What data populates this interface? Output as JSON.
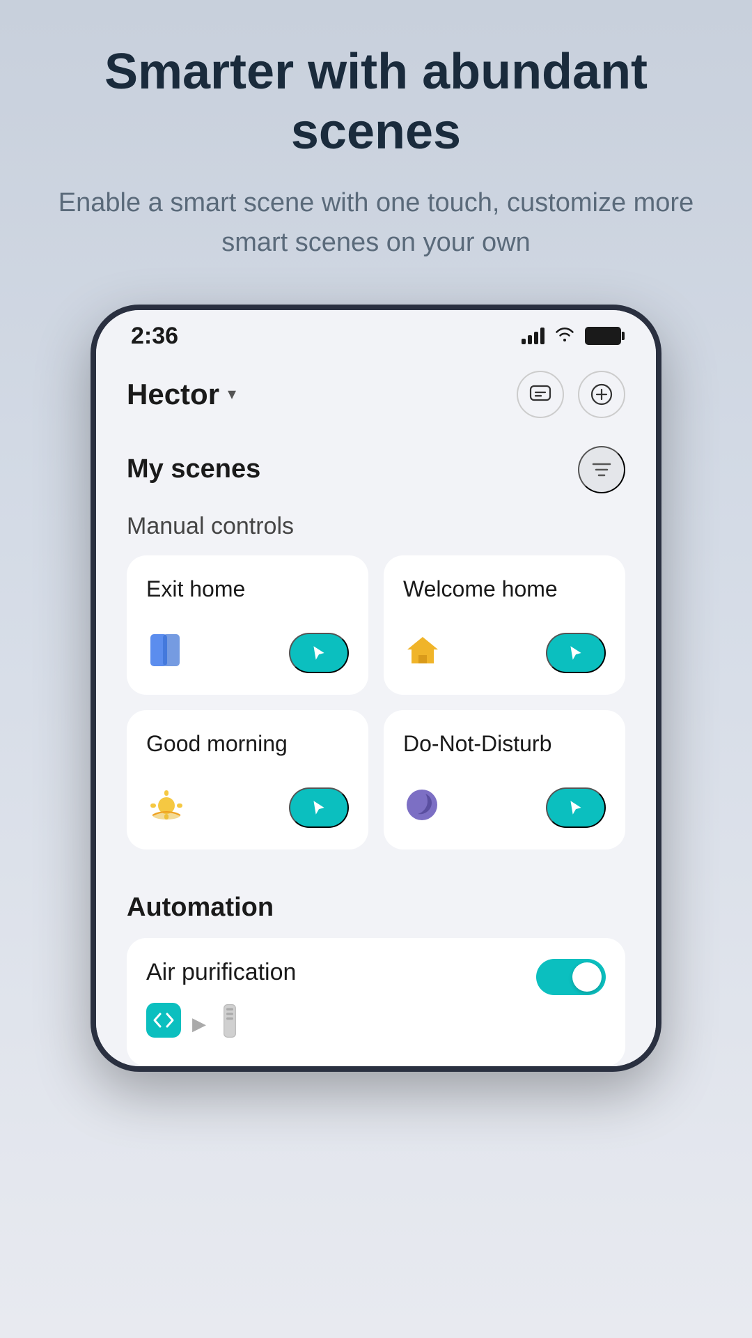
{
  "promo": {
    "title": "Smarter with abundant scenes",
    "subtitle": "Enable a smart scene with one touch, customize more smart scenes on your own"
  },
  "status_bar": {
    "time": "2:36"
  },
  "header": {
    "location": "Hector",
    "message_icon": "💬",
    "add_icon": "+"
  },
  "scenes": {
    "section_title": "My scenes",
    "manual_controls_title": "Manual controls",
    "cards": [
      {
        "title": "Exit home",
        "icon": "🔷",
        "icon_label": "exit-home-icon"
      },
      {
        "title": "Welcome home",
        "icon": "🏠",
        "icon_label": "welcome-home-icon"
      },
      {
        "title": "Good morning",
        "icon": "🌅",
        "icon_label": "good-morning-icon"
      },
      {
        "title": "Do-Not-Disturb",
        "icon": "🌙",
        "icon_label": "do-not-disturb-icon"
      }
    ]
  },
  "automation": {
    "section_title": "Automation",
    "items": [
      {
        "name": "Air purification",
        "toggle_on": true
      }
    ]
  },
  "run_button_label": "▶"
}
